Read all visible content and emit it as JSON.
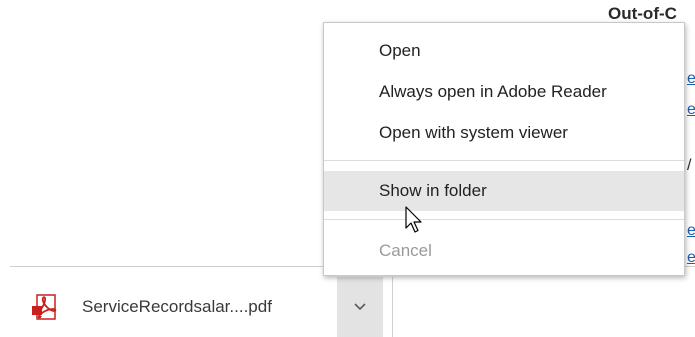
{
  "background": {
    "heading": "Out-of-C",
    "link_fragments": [
      "e",
      "e",
      "e",
      "e"
    ],
    "text_fragment": "/"
  },
  "download_shelf": {
    "file_name": "ServiceRecordsalar....pdf",
    "file_icon": "pdf-icon",
    "menu_toggle_icon": "chevron-down-icon"
  },
  "context_menu": {
    "items": [
      {
        "label": "Open",
        "state": "normal"
      },
      {
        "label": "Always open in Adobe Reader",
        "state": "normal"
      },
      {
        "label": "Open with system viewer",
        "state": "normal"
      },
      {
        "label": "Show in folder",
        "state": "hovered"
      },
      {
        "label": "Cancel",
        "state": "disabled"
      }
    ]
  },
  "colors": {
    "menu_highlight": "#e6e6e6",
    "link": "#1a5fb4",
    "disabled_text": "#9a9a9a",
    "pdf_red": "#c8201e"
  }
}
